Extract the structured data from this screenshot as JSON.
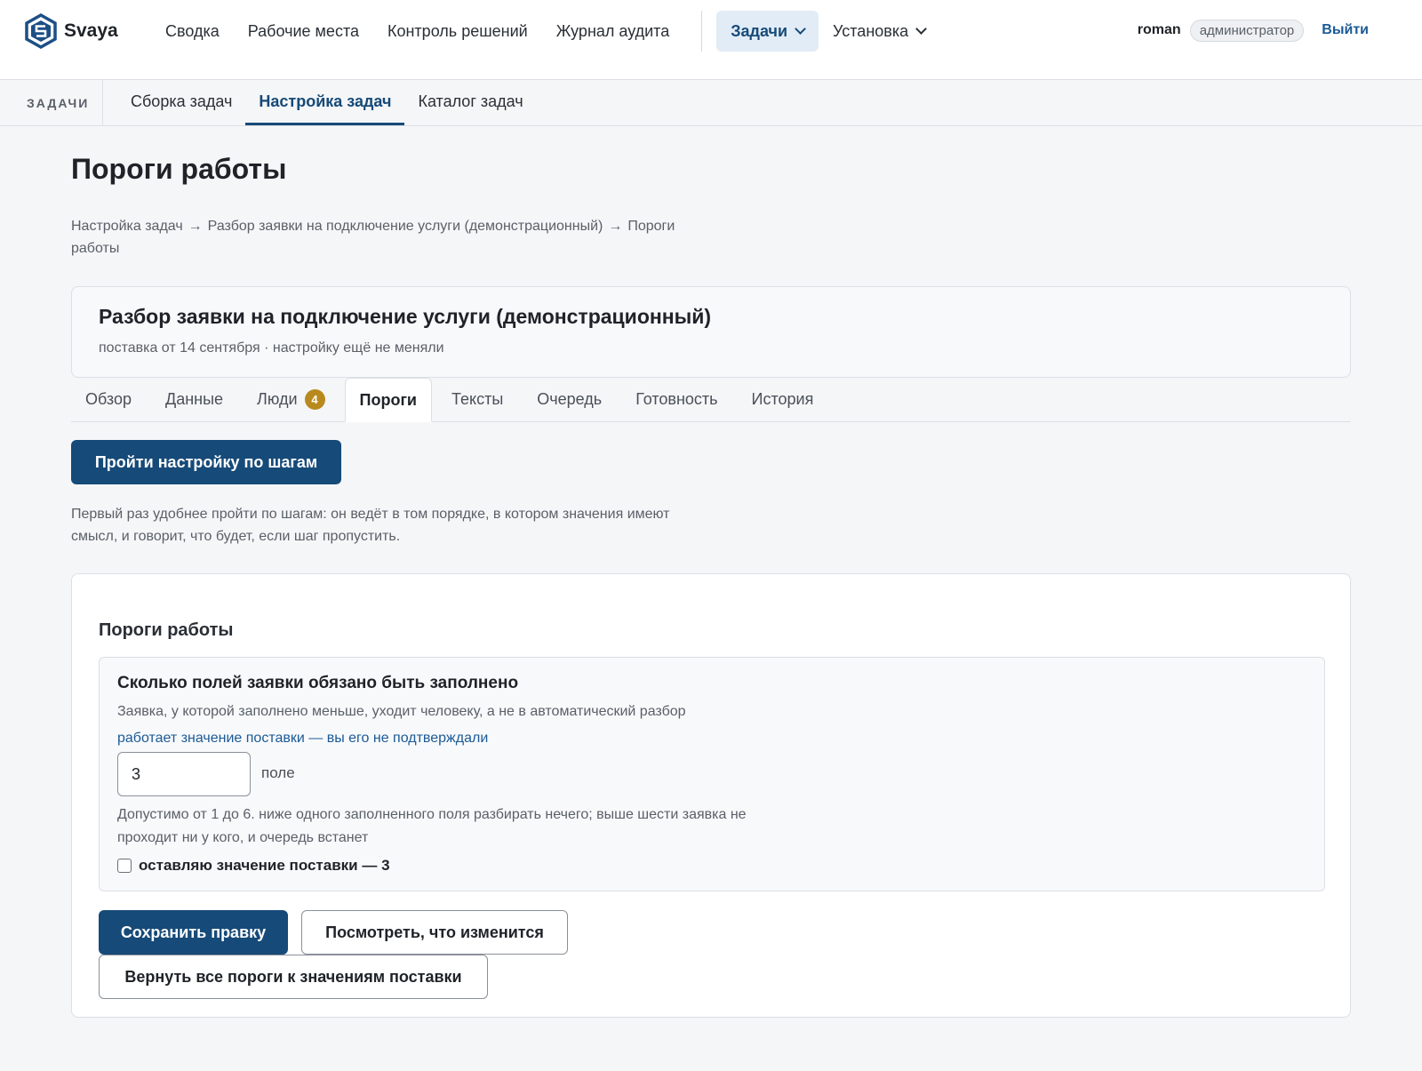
{
  "app": {
    "brand": "Svaya",
    "nav": [
      "Сводка",
      "Рабочие места",
      "Контроль решений",
      "Журнал аудита"
    ],
    "nav_tasks": "Задачи",
    "nav_install": "Установка",
    "user": "roman",
    "role": "администратор",
    "logout": "Выйти"
  },
  "subnav": {
    "label": "ЗАДАЧИ",
    "tabs": [
      "Сборка задач",
      "Настройка задач",
      "Каталог задач"
    ],
    "active": "Настройка задач"
  },
  "page": {
    "title": "Пороги работы",
    "breadcrumb": [
      "Настройка задач",
      "Разбор заявки на подключение услуги (демонстрационный)",
      "Пороги работы"
    ],
    "breadcrumb_sep": "→"
  },
  "task": {
    "title": "Разбор заявки на подключение услуги (демонстрационный)",
    "meta": "поставка от 14 сентября · настройку ещё не меняли"
  },
  "tabs": {
    "items": [
      "Обзор",
      "Данные",
      "Люди",
      "Пороги",
      "Тексты",
      "Очередь",
      "Готовность",
      "История"
    ],
    "people_count": "4",
    "active": "Пороги"
  },
  "wizard": {
    "button": "Пройти настройку по шагам",
    "hint": "Первый раз удобнее пройти по шагам: он ведёт в том порядке, в котором значения имеют смысл, и говорит, что будет, если шаг пропустить."
  },
  "thresholds": {
    "section_title": "Пороги работы",
    "field": {
      "title": "Сколько полей заявки обязано быть заполнено",
      "description": "Заявка, у которой заполнено меньше, уходит человеку, а не в автоматический разбор",
      "source_note": "работает значение поставки — вы его не подтверждали",
      "value": "3",
      "unit": "поле",
      "range_note": "Допустимо от 1 до 6. ниже одного заполненного поля разбирать нечего; выше шести заявка не проходит ни у кого, и очередь встанет",
      "keep_label": "оставляю значение поставки — 3",
      "keep_checked": false
    },
    "save": "Сохранить правку",
    "preview": "Посмотреть, что изменится",
    "reset": "Вернуть все пороги к значениям поставки"
  },
  "colors": {
    "accent": "#164a78",
    "link": "#1a5a96",
    "badge": "#b88a1e",
    "background": "#f5f6f8"
  }
}
